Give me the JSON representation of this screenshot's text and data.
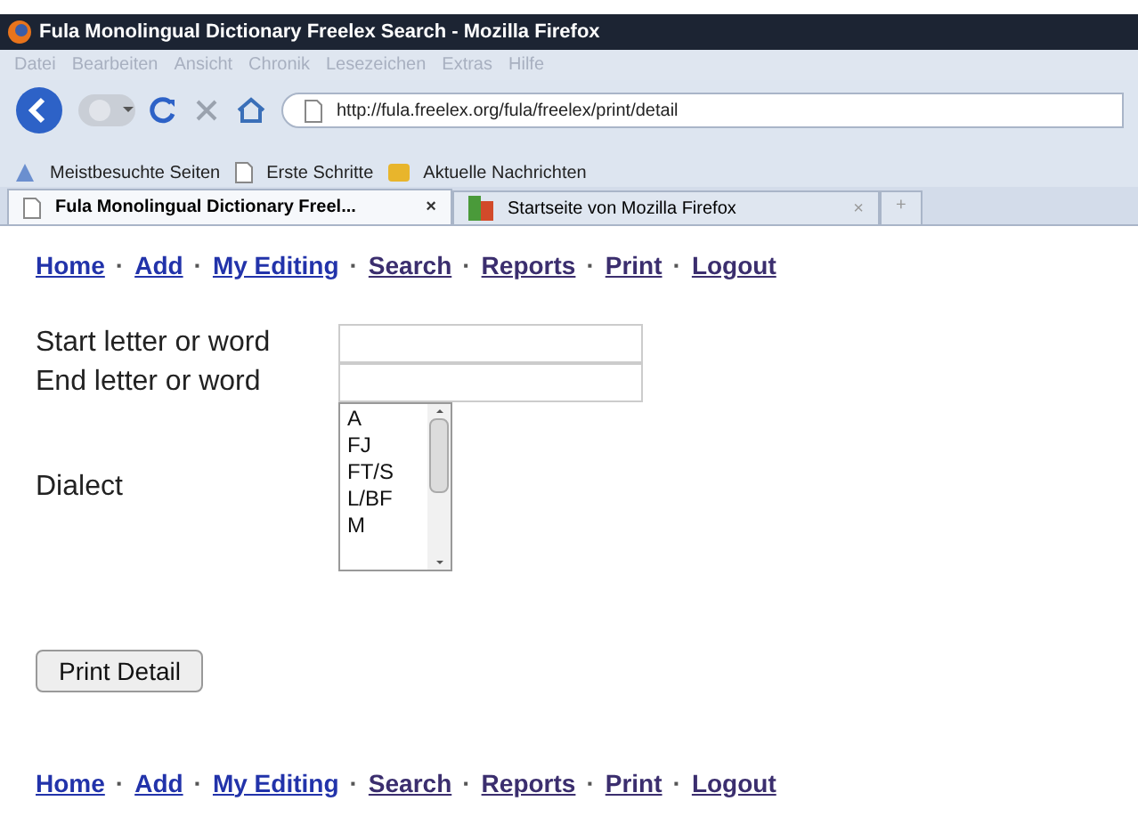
{
  "window": {
    "title": "Fula Monolingual Dictionary Freelex Search - Mozilla Firefox"
  },
  "menu": [
    "Datei",
    "Bearbeiten",
    "Ansicht",
    "Chronik",
    "Lesezeichen",
    "Extras",
    "Hilfe"
  ],
  "address": "http://fula.freelex.org/fula/freelex/print/detail",
  "bookmarks": [
    {
      "label": "Meistbesuchte Seiten",
      "kind": "smart"
    },
    {
      "label": "Erste Schritte",
      "kind": "page"
    },
    {
      "label": "Aktuelle Nachrichten",
      "kind": "feed"
    }
  ],
  "tabs": [
    {
      "label": "Fula Monolingual Dictionary Freel...",
      "selected": true,
      "close": "×"
    },
    {
      "label": "Startseite von Mozilla Firefox",
      "selected": false,
      "close": "×"
    }
  ],
  "new_tab": "+",
  "nav_top": {
    "separator": "·",
    "links": [
      {
        "label": "Home",
        "visited": false
      },
      {
        "label": "Add",
        "visited": false
      },
      {
        "label": "My Editing",
        "visited": false
      },
      {
        "label": "Search",
        "visited": true
      },
      {
        "label": "Reports",
        "visited": true
      },
      {
        "label": "Print",
        "visited": true
      },
      {
        "label": "Logout",
        "visited": true
      }
    ]
  },
  "form": {
    "start_label": "Start letter or word",
    "end_label": "End letter or word",
    "dialect_label": "Dialect",
    "dialects": [
      "A",
      "FJ",
      "FT/S",
      "L/BF",
      "M"
    ],
    "button": "Print Detail"
  },
  "nav_bottom": {
    "separator": "·",
    "links": [
      {
        "label": "Home",
        "visited": false
      },
      {
        "label": "Add",
        "visited": false
      },
      {
        "label": "My Editing",
        "visited": false
      },
      {
        "label": "Search",
        "visited": true
      },
      {
        "label": "Reports",
        "visited": true
      },
      {
        "label": "Print",
        "visited": true
      },
      {
        "label": "Logout",
        "visited": true
      }
    ]
  }
}
